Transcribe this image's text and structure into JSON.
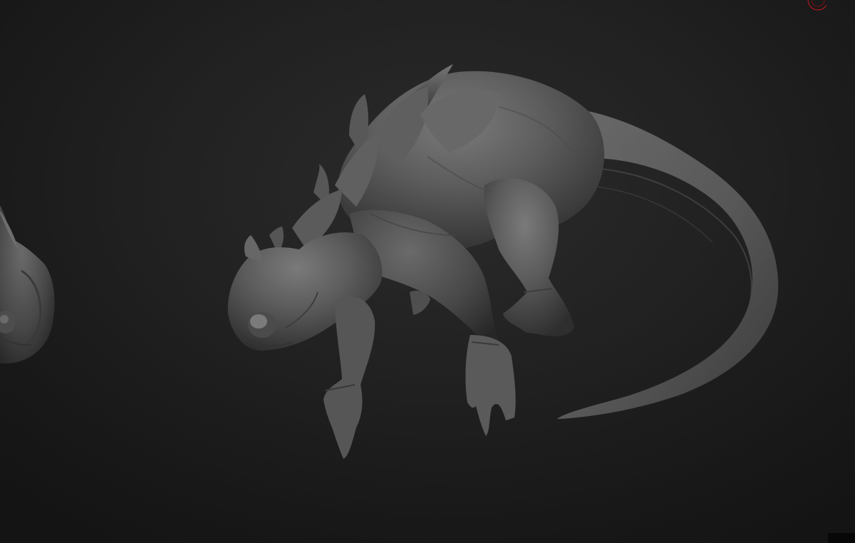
{
  "viewport": {
    "background": "#1c1c1c",
    "model_color": "#5a5a5a",
    "gizmo_color": "#c4161c"
  },
  "objects": [
    {
      "name": "reptile-creature-sculpt",
      "selected": true
    },
    {
      "name": "partial-creature-sculpt",
      "selected": false
    }
  ],
  "icons": [
    "rotation-gizmo-icon"
  ]
}
